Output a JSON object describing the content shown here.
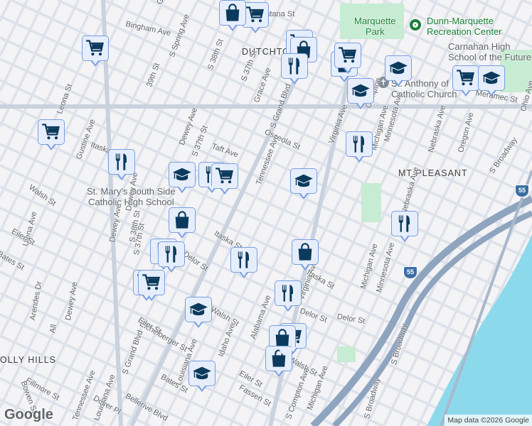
{
  "map": {
    "colors": {
      "background": "#f4f3f5",
      "road": "#dfe3ea",
      "road_major": "#c9d2de",
      "highway": "#8fa4bf",
      "water": "#8dd9ec",
      "park": "#c6ecd3",
      "marker_fill": "#e6eefb",
      "marker_border": "#7a9fe0",
      "marker_icon": "#0c3a5c"
    },
    "areas": [
      "DUTCHTOWN",
      "MT PLEASANT",
      "OLLY HILLS"
    ],
    "pois": {
      "marquette_park": "Marquette\nPark",
      "dunn_marquette": "Dunn-Marquette\nRecreation Center",
      "carnahan": "Carnahan High\nSchool of the Future",
      "st_anthony": "St. Anthony of\nCatholic Church",
      "st_marys": "St. Mary's South Side\nCatholic High School"
    },
    "streets": [
      "Montana St",
      "Bingham Ave",
      "Gingsland Ct",
      "S Spring Ave",
      "S 38th St",
      "S 37th St",
      "39th St",
      "Grace Ave",
      "S Grand Blvd",
      "Leona St",
      "Gustine Ave",
      "Itaska St",
      "Dewey Ave",
      "S 37th St",
      "Taft Ave",
      "Osceola St",
      "Tennessee Ave",
      "Virginia Ave",
      "Compton",
      "Michigan Ave",
      "Minnesota Ave",
      "Nebraska Ave",
      "Oregon Ave",
      "Ohio Ave",
      "Meramec St",
      "S Broadway",
      "Walsh St",
      "Ulena Ave",
      "Eiler St",
      "Bates St",
      "Dewey Ave",
      "S 37th St",
      "Delor St",
      "Itaska St",
      "Arendes Dr",
      "Dewey Ave",
      "S Grand Blvd",
      "Eichelberger St",
      "Eiler St",
      "Walsh St",
      "Idaho Ave",
      "Alabama Ave",
      "Virginia Ave",
      "Itaska St",
      "Delor St",
      "Delor St",
      "Michigan Ave",
      "Minnesota Ave",
      "S Broadway",
      "Louisiana Ave",
      "Bates St",
      "Eiler St",
      "Fassen St",
      "Walsh St",
      "S Compton Ave",
      "Michigan Ave",
      "Fillmore St",
      "Bowen St",
      "Dover Pl",
      "Bellerive Blvd",
      "Tennessee Ave",
      "Louisiana Ave",
      "Nebraska Ave",
      "Dewey Ave",
      "S 38th St",
      "S Broadway",
      "All"
    ],
    "shields": [
      "55",
      "55"
    ],
    "google_logo": "Google",
    "attribution": "Map data ©2026 Google",
    "markers": [
      {
        "type": "cart"
      },
      {
        "type": "cart"
      },
      {
        "type": "cart"
      },
      {
        "type": "restaurant"
      },
      {
        "type": "school"
      },
      {
        "type": "restaurant"
      },
      {
        "type": "cart"
      },
      {
        "type": "bag"
      },
      {
        "type": "restaurant"
      },
      {
        "type": "restaurant"
      },
      {
        "type": "cart"
      },
      {
        "type": "cart"
      },
      {
        "type": "school"
      },
      {
        "type": "restaurant"
      },
      {
        "type": "restaurant"
      },
      {
        "type": "cart"
      },
      {
        "type": "bag"
      },
      {
        "type": "bag"
      },
      {
        "type": "school"
      },
      {
        "type": "bag"
      },
      {
        "type": "school"
      },
      {
        "type": "restaurant"
      },
      {
        "type": "cart"
      },
      {
        "type": "bag"
      },
      {
        "type": "restaurant"
      },
      {
        "type": "bag"
      },
      {
        "type": "school"
      },
      {
        "type": "school"
      },
      {
        "type": "cart"
      },
      {
        "type": "school"
      },
      {
        "type": "restaurant"
      },
      {
        "type": "bag"
      },
      {
        "type": "cart"
      }
    ]
  }
}
